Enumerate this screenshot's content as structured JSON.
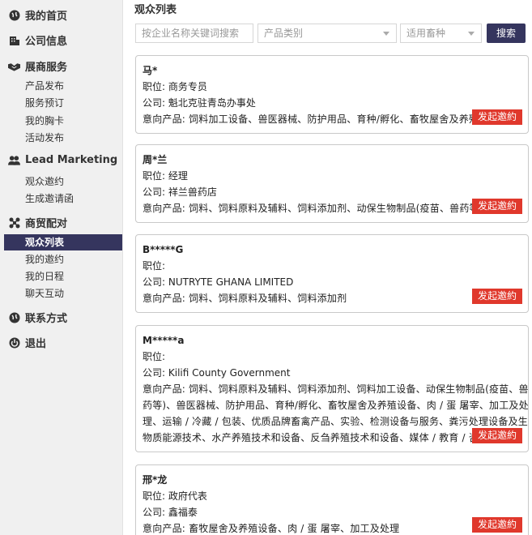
{
  "sidebar": {
    "home": "我的首页",
    "company": "公司信息",
    "exhibitor": "展商服务",
    "exhibitor_items": [
      "产品发布",
      "服务预订",
      "我的胸卡",
      "活动发布"
    ],
    "lead": "Lead Marketing",
    "lead_items": [
      "观众邀约",
      "生成邀请函"
    ],
    "match": "商贸配对",
    "match_items": [
      "观众列表",
      "我的邀约",
      "我的日程",
      "聊天互动"
    ],
    "contact": "联系方式",
    "logout": "退出"
  },
  "main": {
    "title": "观众列表",
    "search": {
      "keyword_placeholder": "按企业名称关键词搜索",
      "category_placeholder": "产品类别",
      "species_placeholder": "适用畜种",
      "button": "搜索"
    },
    "labels": {
      "position": "职位: ",
      "company": "公司: ",
      "intent": "意向产品: "
    },
    "invite_label": "发起邀約",
    "cards": [
      {
        "name": "马*",
        "position": "商务专员",
        "company": "魁北克驻青岛办事处",
        "intent": "饲料加工设备、兽医器械、防护用品、育种/孵化、畜牧屋舍及养殖"
      },
      {
        "name": "周*兰",
        "position": "经理",
        "company": "祥兰兽药店",
        "intent": "饲料、饲料原料及辅料、饲料添加剂、动保生物制品(疫苗、兽药等"
      },
      {
        "name": "B*****G",
        "position": "",
        "company": "NUTRYTE GHANA LIMITED",
        "intent": "饲料、饲料原料及辅料、饲料添加剂"
      },
      {
        "name": "M*****a",
        "position": "",
        "company": "Kilifi County Government",
        "intent_lines": [
          "饲料、饲料原料及辅料、饲料添加剂、饲料加工设备、动保生物制品(疫苗、兽",
          "药等)、兽医器械、防护用品、育种/孵化、畜牧屋舍及养殖设备、肉 / 蛋 屠宰、加工及处",
          "理、运输 / 冷藏 / 包装、优质品牌畜禽产品、实验、检测设备与服务、粪污处理设备及生",
          "物质能源技术、水产养殖技术和设备、反刍养殖技术和设备、媒体 / 教育 / 咨询"
        ]
      },
      {
        "name": "邢*龙",
        "position": "政府代表",
        "company": "鑫福泰",
        "intent": "畜牧屋舍及养殖设备、肉 / 蛋 屠宰、加工及处理"
      }
    ]
  }
}
